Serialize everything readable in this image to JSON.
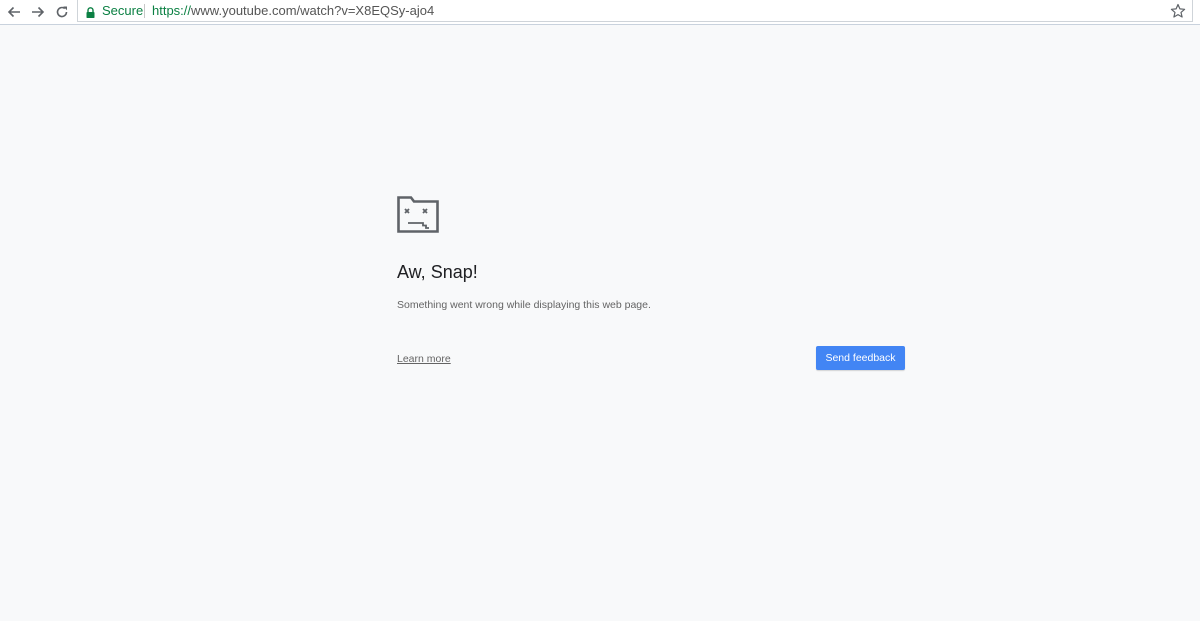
{
  "browser": {
    "security_label": "Secure",
    "url_scheme": "https://",
    "url_rest": "www.youtube.com/watch?v=X8EQSy-ajo4",
    "icons": {
      "back": "back-arrow-icon",
      "forward": "forward-arrow-icon",
      "reload": "reload-icon",
      "lock": "lock-icon",
      "bookmark": "star-icon"
    },
    "colors": {
      "secure": "#0b8043"
    }
  },
  "error_page": {
    "icon": "sad-tab-icon",
    "title": "Aw, Snap!",
    "message": "Something went wrong while displaying this web page.",
    "learn_more_label": "Learn more",
    "feedback_button_label": "Send feedback",
    "colors": {
      "button": "#4285f4",
      "background": "#f8f9fa"
    }
  }
}
